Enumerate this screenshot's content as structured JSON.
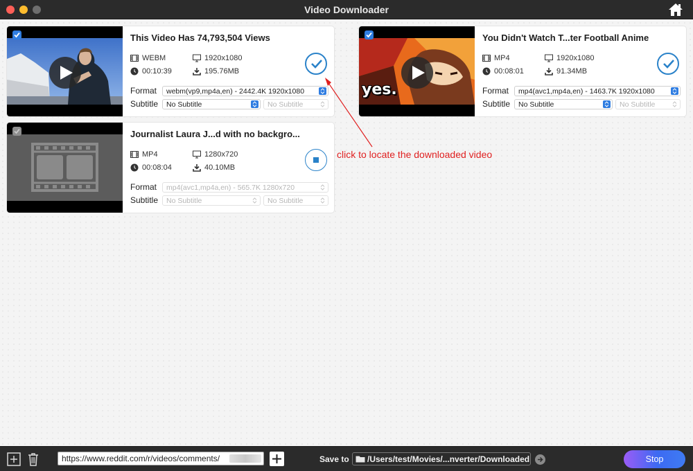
{
  "window": {
    "title": "Video Downloader",
    "home_icon": "home-icon"
  },
  "colors": {
    "accent": "#2f7de1",
    "done": "#2a82c9",
    "annotation": "#e02020",
    "stop_gradient_start": "#9b5cf6",
    "stop_gradient_end": "#3f7bf3"
  },
  "videos": [
    {
      "title": "This Video Has 74,793,504 Views",
      "format": "WEBM",
      "resolution": "1920x1080",
      "duration": "00:10:39",
      "size": "195.76MB",
      "format_option": "webm(vp9,mp4a,en) - 2442.4K 1920x1080",
      "subtitle_option": "No Subtitle",
      "subtitle2_option": "No Subtitle",
      "status": "done",
      "checked": true
    },
    {
      "title": "You Didn't Watch T...ter Football Anime",
      "format": "MP4",
      "resolution": "1920x1080",
      "duration": "00:08:01",
      "size": "91.34MB",
      "format_option": "mp4(avc1,mp4a,en) - 1463.7K 1920x1080",
      "subtitle_option": "No Subtitle",
      "subtitle2_option": "No Subtitle",
      "thumb_text": "yes.",
      "status": "done",
      "checked": true
    },
    {
      "title": "Journalist Laura J...d with no backgro...",
      "format": "MP4",
      "resolution": "1280x720",
      "duration": "00:08:04",
      "size": "40.10MB",
      "format_option": "mp4(avc1,mp4a,en) - 565.7K 1280x720",
      "subtitle_option": "No Subtitle",
      "subtitle2_option": "No Subtitle",
      "status": "downloading",
      "checked": true
    }
  ],
  "labels": {
    "format": "Format",
    "subtitle": "Subtitle"
  },
  "annotation": "click to locate the downloaded video",
  "bottom": {
    "url": "https://www.reddit.com/r/videos/comments/",
    "save_to_label": "Save to",
    "save_path": "/Users/test/Movies/...nverter/Downloaded",
    "stop_label": "Stop"
  }
}
